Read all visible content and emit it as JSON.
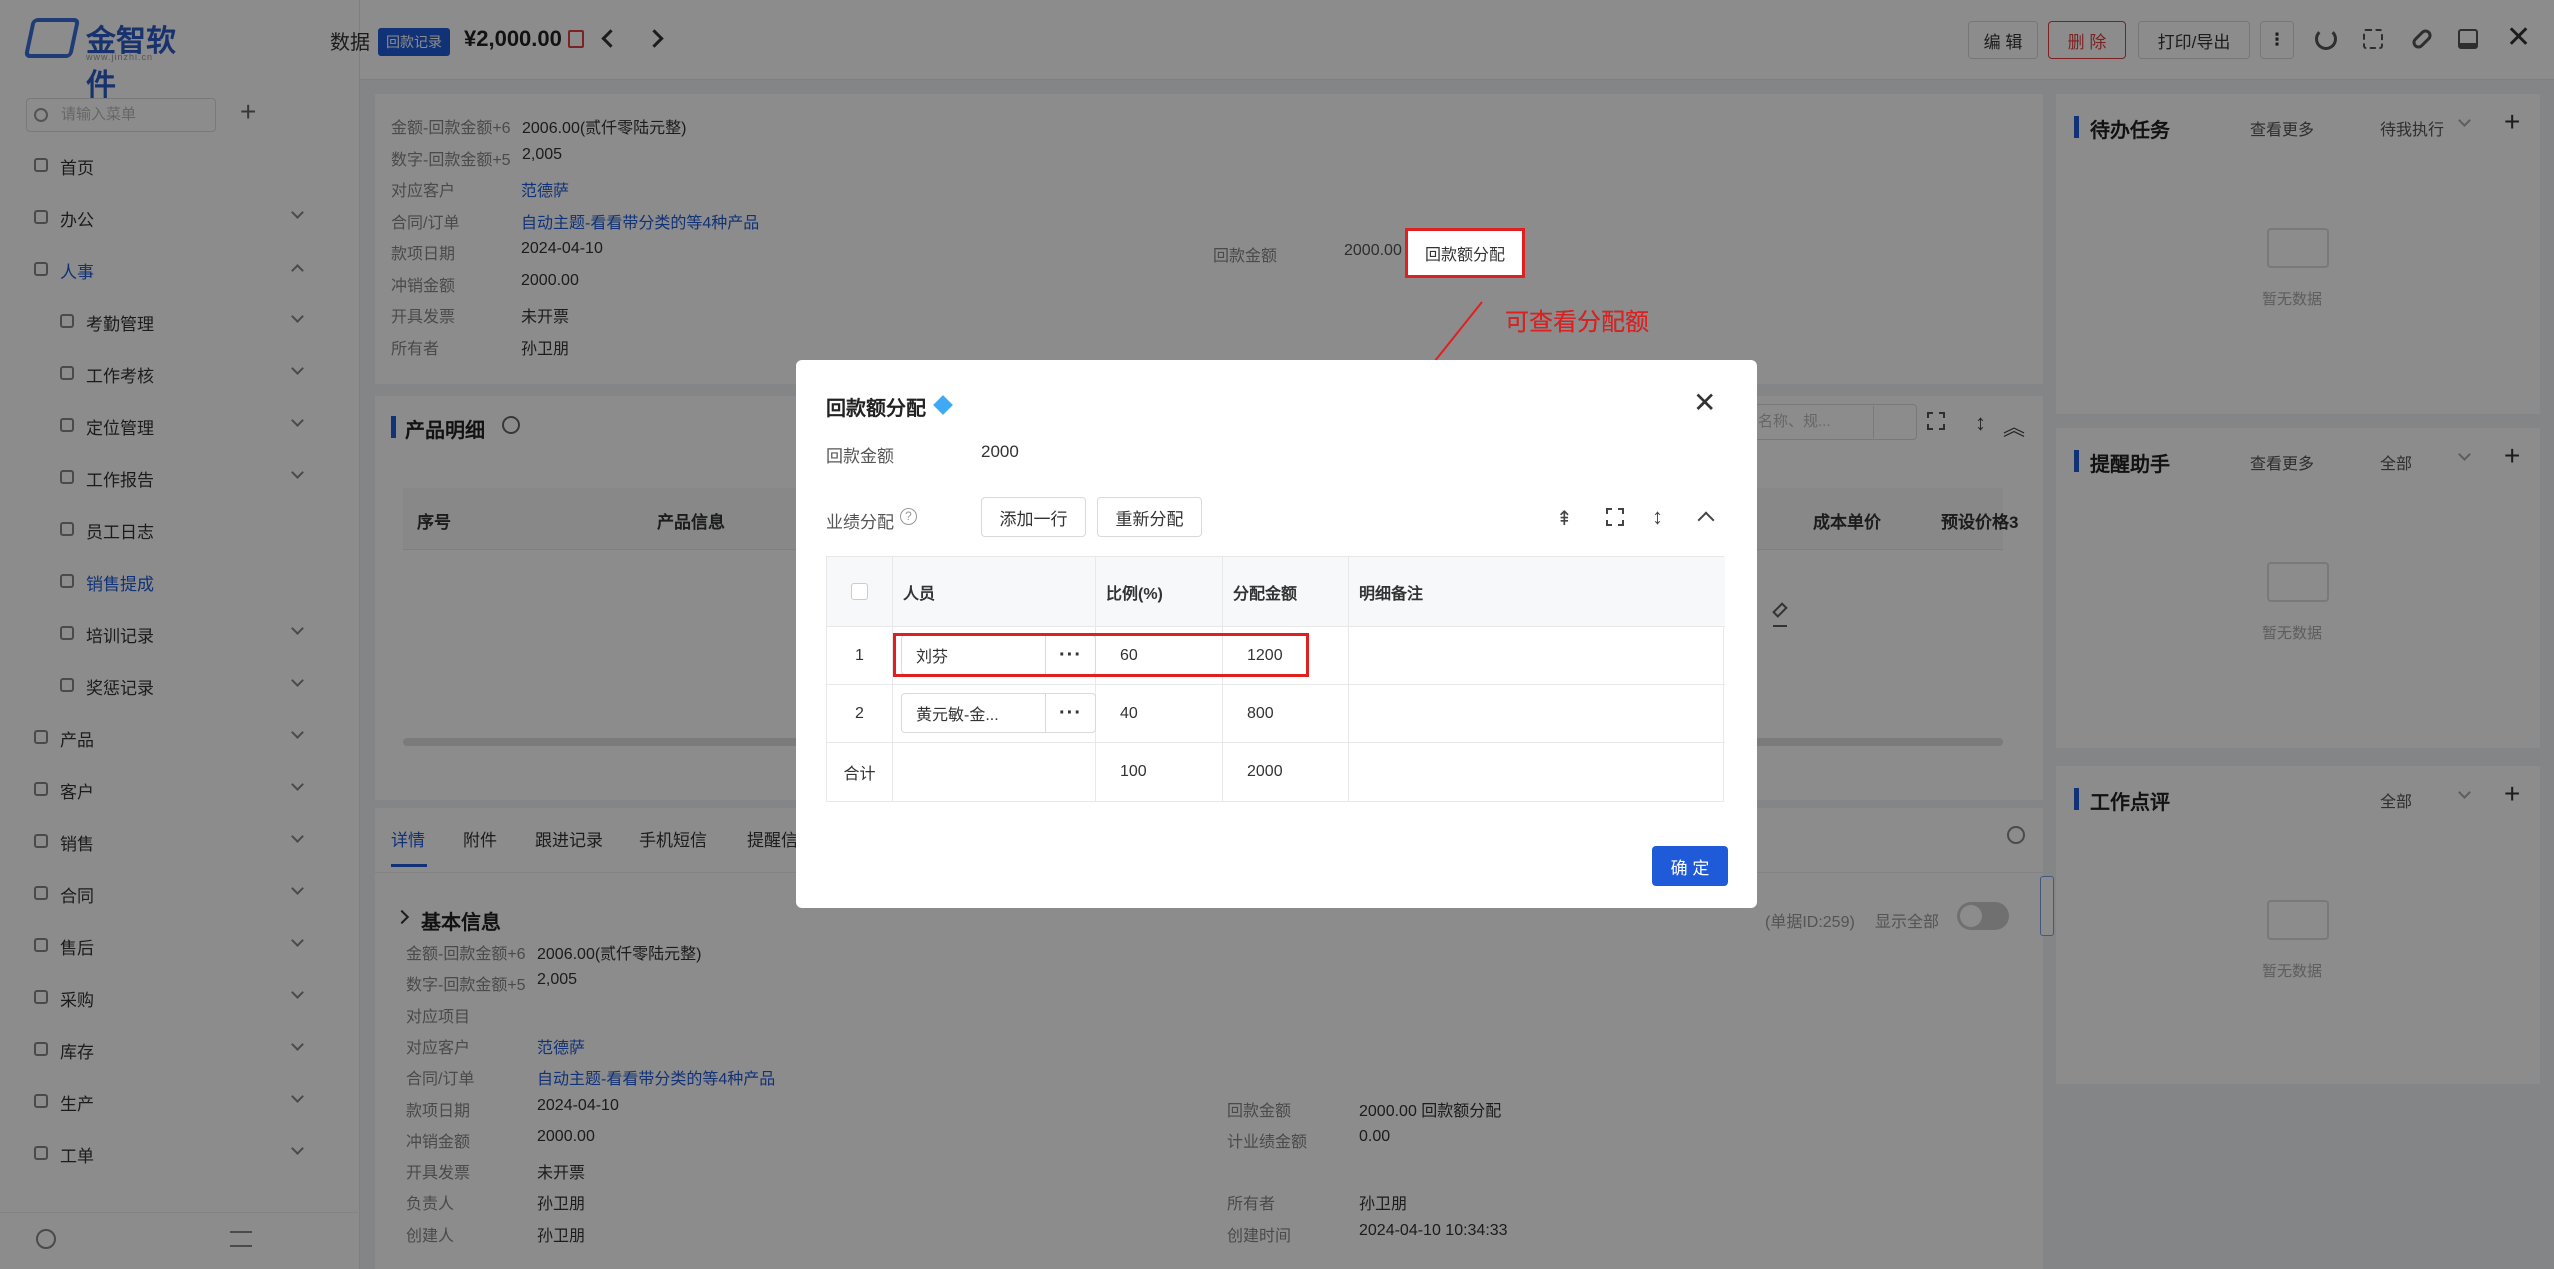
{
  "sidebar": {
    "logo_text": "金智软件",
    "logo_sub": "www.jinzhi.cn",
    "search_placeholder": "请输入菜单",
    "items": [
      {
        "label": "首页",
        "sub": false,
        "arrow": ""
      },
      {
        "label": "办公",
        "sub": false,
        "arrow": "down"
      },
      {
        "label": "人事",
        "sub": false,
        "arrow": "up",
        "active": true
      },
      {
        "label": "考勤管理",
        "sub": true,
        "arrow": "down"
      },
      {
        "label": "工作考核",
        "sub": true,
        "arrow": "down"
      },
      {
        "label": "定位管理",
        "sub": true,
        "arrow": "down"
      },
      {
        "label": "工作报告",
        "sub": true,
        "arrow": "down"
      },
      {
        "label": "员工日志",
        "sub": true,
        "arrow": ""
      },
      {
        "label": "销售提成",
        "sub": true,
        "arrow": "",
        "active": true
      },
      {
        "label": "培训记录",
        "sub": true,
        "arrow": "down"
      },
      {
        "label": "奖惩记录",
        "sub": true,
        "arrow": "down"
      },
      {
        "label": "产品",
        "sub": false,
        "arrow": "down"
      },
      {
        "label": "客户",
        "sub": false,
        "arrow": "down"
      },
      {
        "label": "销售",
        "sub": false,
        "arrow": "down"
      },
      {
        "label": "合同",
        "sub": false,
        "arrow": "down"
      },
      {
        "label": "售后",
        "sub": false,
        "arrow": "down"
      },
      {
        "label": "采购",
        "sub": false,
        "arrow": "down"
      },
      {
        "label": "库存",
        "sub": false,
        "arrow": "down"
      },
      {
        "label": "生产",
        "sub": false,
        "arrow": "down"
      },
      {
        "label": "工单",
        "sub": false,
        "arrow": "down"
      }
    ]
  },
  "topbar": {
    "left_cut_text": "数据",
    "tag": "回款记录",
    "amount": "¥2,000.00",
    "edit": "编 辑",
    "delete": "删 除",
    "print": "打印/导出"
  },
  "details_top": {
    "rows": [
      {
        "label": "金额-回款金额+6",
        "value": "2006.00(贰仟零陆元整)",
        "link": false
      },
      {
        "label": "数字-回款金额+5",
        "value": "2,005",
        "link": false
      },
      {
        "label": "对应客户",
        "value": "范德萨",
        "link": true
      },
      {
        "label": "合同/订单",
        "value": "自动主题-看看带分类的等4种产品",
        "link": true
      },
      {
        "label": "款项日期",
        "value": "2024-04-10",
        "link": false
      },
      {
        "label": "冲销金额",
        "value": "2000.00",
        "link": false
      },
      {
        "label": "开具发票",
        "value": "未开票",
        "link": false
      },
      {
        "label": "所有者",
        "value": "孙卫朋",
        "link": false
      }
    ],
    "receipt_label": "回款金额",
    "receipt_value": "2000.00",
    "alloc_button": "回款额分配"
  },
  "annotation": "可查看分配额",
  "products": {
    "title": "产品明细",
    "search_placeholder": "名称、规...",
    "cols": [
      "序号",
      "产品信息",
      "成本单价",
      "预设价格3"
    ]
  },
  "tabs": [
    "详情",
    "附件",
    "跟进记录",
    "手机短信",
    "提醒信"
  ],
  "basic": {
    "title": "基本信息",
    "doc_id": "(单据ID:259)",
    "show_all": "显示全部",
    "left": [
      {
        "label": "金额-回款金额+6",
        "value": "2006.00(贰仟零陆元整)",
        "link": false
      },
      {
        "label": "数字-回款金额+5",
        "value": "2,005",
        "link": false
      },
      {
        "label": "对应项目",
        "value": "",
        "link": false
      },
      {
        "label": "对应客户",
        "value": "范德萨",
        "link": true
      },
      {
        "label": "合同/订单",
        "value": "自动主题-看看带分类的等4种产品",
        "link": true
      },
      {
        "label": "款项日期",
        "value": "2024-04-10",
        "link": false
      },
      {
        "label": "冲销金额",
        "value": "2000.00",
        "link": false
      },
      {
        "label": "开具发票",
        "value": "未开票",
        "link": false
      },
      {
        "label": "负责人",
        "value": "孙卫朋",
        "link": false
      },
      {
        "label": "创建人",
        "value": "孙卫朋",
        "link": false
      }
    ],
    "right": [
      {
        "label": "回款金额",
        "value": "2000.00  回款额分配",
        "row": 5
      },
      {
        "label": "计业绩金额",
        "value": "0.00",
        "row": 6
      },
      {
        "label": "所有者",
        "value": "孙卫朋",
        "row": 8
      },
      {
        "label": "创建时间",
        "value": "2024-04-10 10:34:33",
        "row": 9
      }
    ]
  },
  "right_panels": [
    {
      "title": "待办任务",
      "more": "查看更多",
      "filter": "待我执行",
      "empty": "暂无数据"
    },
    {
      "title": "提醒助手",
      "more": "查看更多",
      "filter": "全部",
      "empty": "暂无数据"
    },
    {
      "title": "工作点评",
      "more": "",
      "filter": "全部",
      "empty": "暂无数据"
    }
  ],
  "modal": {
    "title": "回款额分配",
    "amount_label": "回款金额",
    "amount_value": "2000",
    "perf_label": "业绩分配",
    "add_row": "添加一行",
    "redistribute": "重新分配",
    "cols": {
      "person": "人员",
      "ratio": "比例(%)",
      "alloc": "分配金额",
      "note": "明细备注"
    },
    "rows": [
      {
        "index": "1",
        "person": "刘芬",
        "ratio": "60",
        "amount": "1200"
      },
      {
        "index": "2",
        "person": "黄元敏-金...",
        "ratio": "40",
        "amount": "800"
      }
    ],
    "total": {
      "label": "合计",
      "ratio": "100",
      "amount": "2000"
    },
    "confirm": "确 定"
  },
  "colors": {
    "primary": "#1f5bd8",
    "danger": "#e02020"
  }
}
